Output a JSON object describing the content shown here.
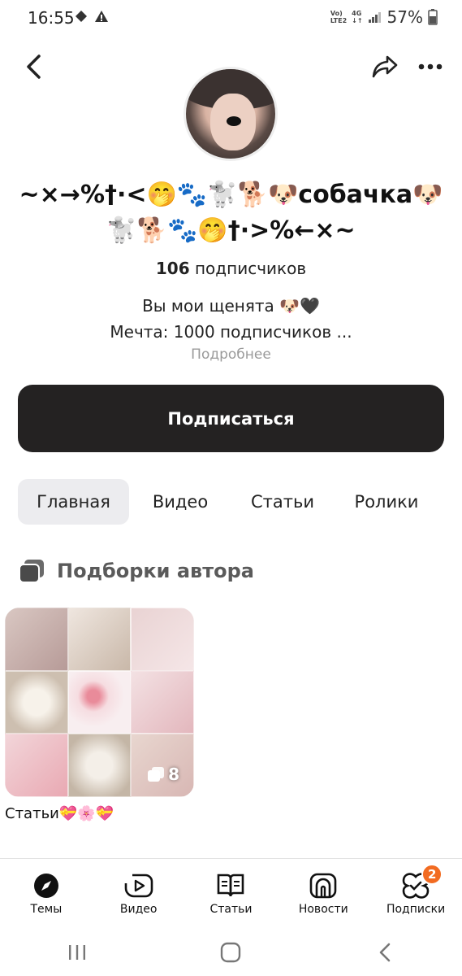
{
  "status_bar": {
    "time": "16:55",
    "network_top": "Vo)",
    "network_bottom": "LTE2",
    "signal_type_top": "4G",
    "signal_type_bottom": "↓↑",
    "battery": "57%"
  },
  "profile": {
    "name": "~×→%†·<🤭🐾🐩🐕🐶собачка🐶🐩🐕🐾🤭†·>%←×~",
    "subscribers_count": "106",
    "subscribers_label": "подписчиков",
    "bio_line1": "Вы мои щенята 🐶🖤",
    "bio_line2": "Мечта: 1000 подписчиков ...",
    "more_label": "Подробнее",
    "subscribe_label": "Подписаться"
  },
  "tabs": [
    {
      "label": "Главная",
      "active": true
    },
    {
      "label": "Видео",
      "active": false
    },
    {
      "label": "Статьи",
      "active": false
    },
    {
      "label": "Ролики",
      "active": false
    }
  ],
  "section": {
    "title": "Подборки автора"
  },
  "collection": {
    "count": "8",
    "label": "Статьи💝🌸💝"
  },
  "bottom_nav": [
    {
      "label": "Темы",
      "icon": "compass-icon"
    },
    {
      "label": "Видео",
      "icon": "play-icon"
    },
    {
      "label": "Статьи",
      "icon": "book-icon"
    },
    {
      "label": "Новости",
      "icon": "news-icon"
    },
    {
      "label": "Подписки",
      "icon": "subscriptions-icon",
      "badge": "2"
    }
  ],
  "colors": {
    "subscribe_bg": "#242222",
    "badge": "#f26b21",
    "tab_active_bg": "#ececef"
  }
}
